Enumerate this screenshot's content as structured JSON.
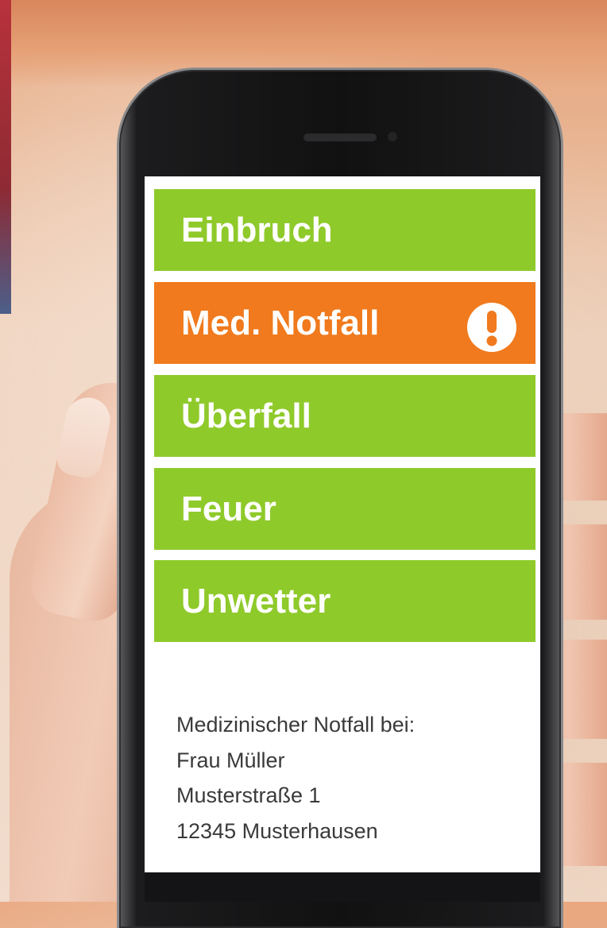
{
  "emergency_menu": {
    "items": [
      {
        "label": "Einbruch",
        "state": "normal"
      },
      {
        "label": "Med. Notfall",
        "state": "selected",
        "icon": "exclamation-circle-icon"
      },
      {
        "label": "Überfall",
        "state": "normal"
      },
      {
        "label": "Feuer",
        "state": "normal"
      },
      {
        "label": "Unwetter",
        "state": "normal"
      }
    ]
  },
  "alert_details": {
    "heading": "Medizinischer Notfall bei:",
    "name": "Frau Müller",
    "street": "Musterstraße 1",
    "city": "12345 Musterhausen"
  },
  "colors": {
    "normal_button": "#8fca2b",
    "selected_button": "#f07a1d",
    "screen_background": "#ffffff",
    "details_text": "#3a3a3a"
  }
}
